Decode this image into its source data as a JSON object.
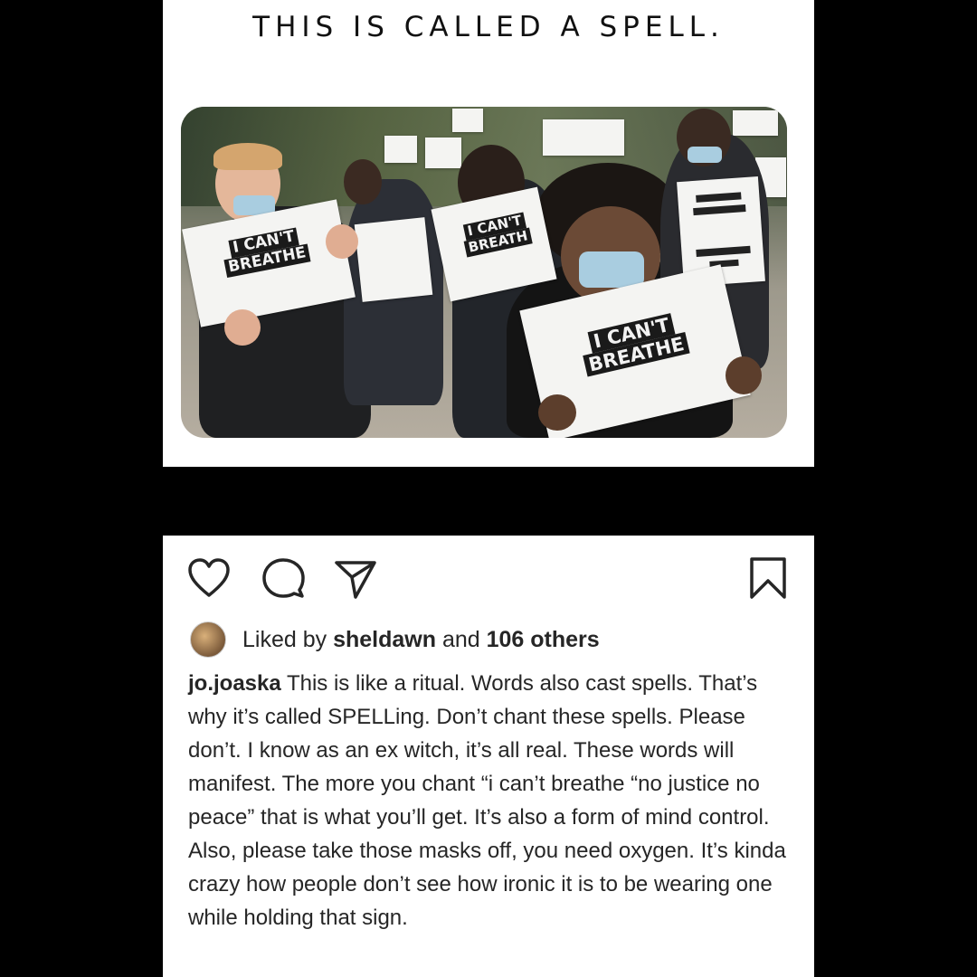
{
  "meme": {
    "title": "THIS IS CALLED A SPELL.",
    "signs": {
      "left": [
        "I CAN'T",
        "BREATHE"
      ],
      "middle": [
        "I CAN'T",
        "BREATH"
      ],
      "front": [
        "I CAN'T",
        "BREATHE"
      ]
    }
  },
  "post": {
    "actions": [
      "heart-icon",
      "comment-icon",
      "share-icon",
      "bookmark-icon"
    ],
    "liked_by_prefix": "Liked by",
    "liked_by_user": "sheldawn",
    "liked_by_and": "and",
    "liked_by_others": "106 others",
    "caption_user": "jo.joaska",
    "caption_lines": [
      "This is like a ritual. Words also cast spells. That’s why it’s called SPELLing. Don’t chant these spells. Please don’t. I know as an ex witch, it’s all real. These words will manifest. The more you chant “i can’t breathe “no justice no peace” that is what you’ll get. It’s also a form of mind control.",
      "Also, please take those masks off, you need oxygen. It’s kinda crazy how people don’t see how ironic it is to be wearing one while holding that sign."
    ]
  }
}
